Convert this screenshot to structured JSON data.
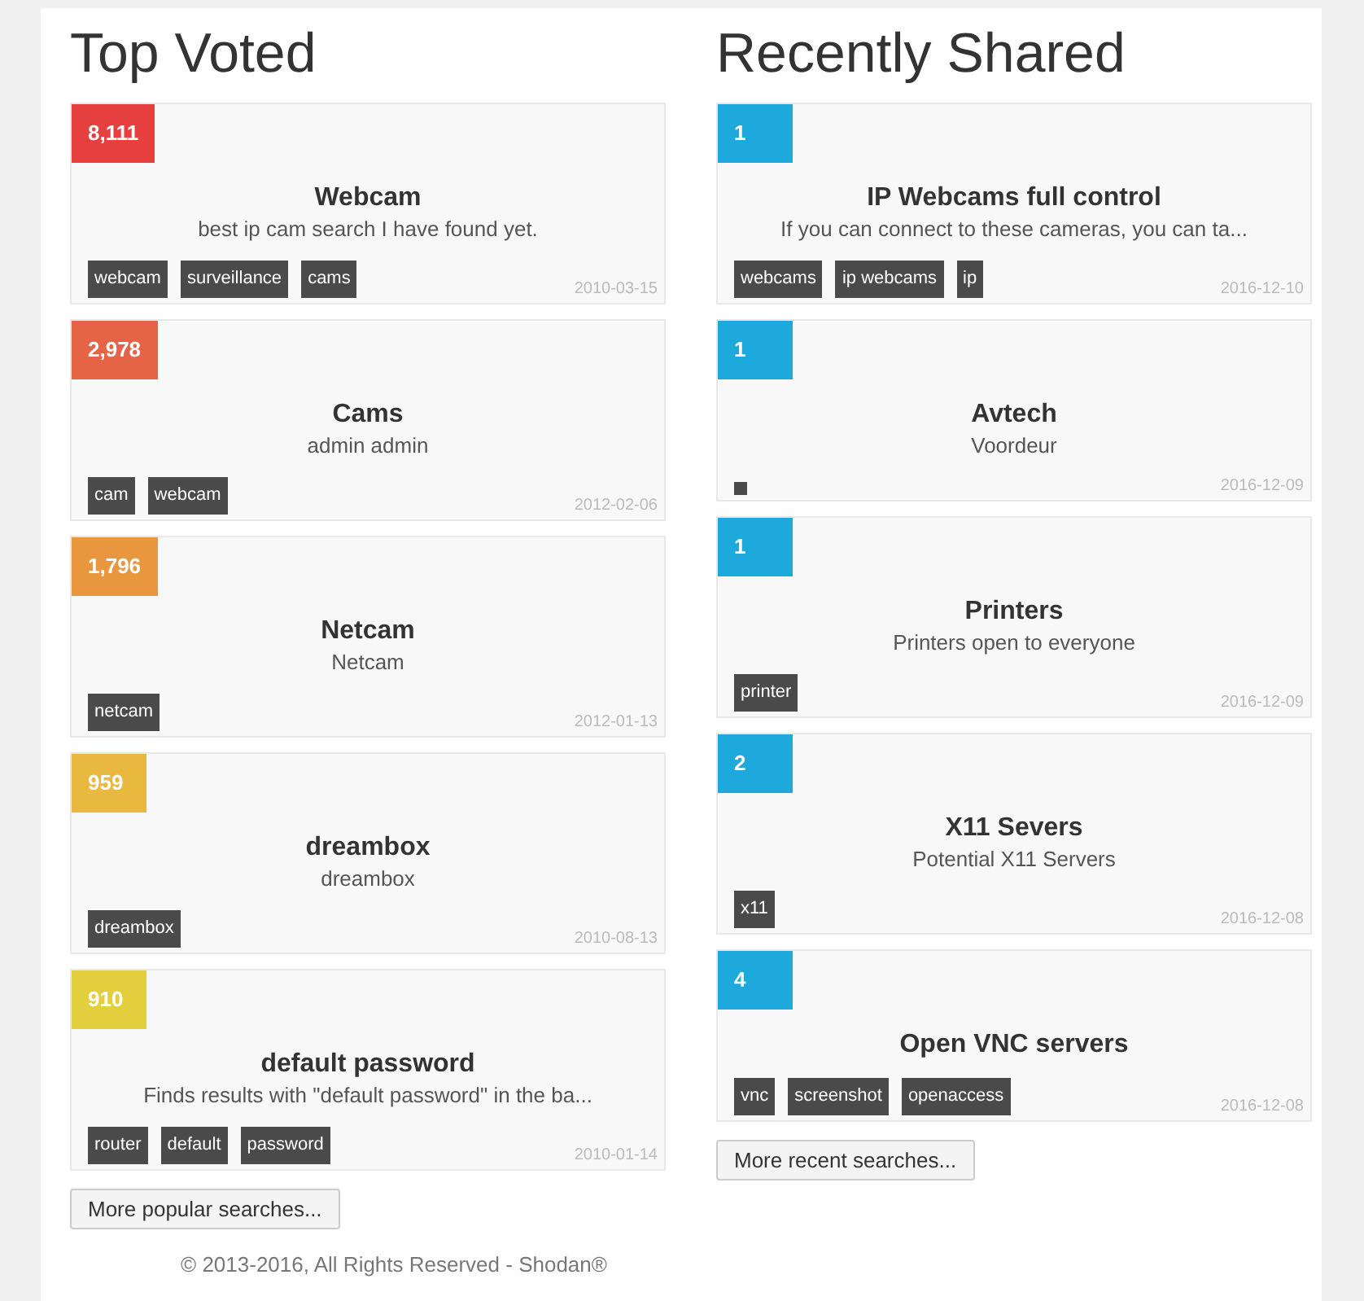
{
  "columns": [
    {
      "heading": "Top Voted",
      "cards": [
        {
          "votes": "8,111",
          "color": "#e5403f",
          "title": "Webcam",
          "description": "best ip cam search I have found yet.",
          "tags": [
            "webcam",
            "surveillance",
            "cams"
          ],
          "date": "2010-03-15"
        },
        {
          "votes": "2,978",
          "color": "#e56445",
          "title": "Cams",
          "description": "admin admin",
          "tags": [
            "cam",
            "webcam"
          ],
          "date": "2012-02-06"
        },
        {
          "votes": "1,796",
          "color": "#e8973f",
          "title": "Netcam",
          "description": "Netcam",
          "tags": [
            "netcam"
          ],
          "date": "2012-01-13"
        },
        {
          "votes": "959",
          "color": "#e8b83f",
          "title": "dreambox",
          "description": "dreambox",
          "tags": [
            "dreambox"
          ],
          "date": "2010-08-13"
        },
        {
          "votes": "910",
          "color": "#e3cf3d",
          "title": "default password",
          "description": "Finds results with \"default password\" in the ba...",
          "tags": [
            "router",
            "default",
            "password"
          ],
          "date": "2010-01-14"
        }
      ],
      "more": "More popular searches..."
    },
    {
      "heading": "Recently Shared",
      "cards": [
        {
          "votes": "1",
          "color": "#1ea9dc",
          "title": "IP Webcams full control",
          "description": "If you can connect to these cameras, you can ta...",
          "tags": [
            "webcams",
            "ip webcams",
            "ip"
          ],
          "date": "2016-12-10"
        },
        {
          "votes": "1",
          "color": "#1ea9dc",
          "title": "Avtech",
          "description": "Voordeur",
          "blank_tag": true,
          "date": "2016-12-09"
        },
        {
          "votes": "1",
          "color": "#1ea9dc",
          "title": "Printers",
          "description": "Printers open to everyone",
          "tags": [
            "printer"
          ],
          "date": "2016-12-09"
        },
        {
          "votes": "2",
          "color": "#1ea9dc",
          "title": "X11 Severs",
          "description": "Potential X11 Servers",
          "tags": [
            "x11"
          ],
          "date": "2016-12-08"
        },
        {
          "votes": "4",
          "color": "#1ea9dc",
          "title": "Open VNC servers",
          "tags": [
            "vnc",
            "screenshot",
            "openaccess"
          ],
          "date": "2016-12-08"
        }
      ],
      "more": "More recent searches..."
    }
  ],
  "footer": "© 2013-2016, All Rights Reserved - Shodan®"
}
